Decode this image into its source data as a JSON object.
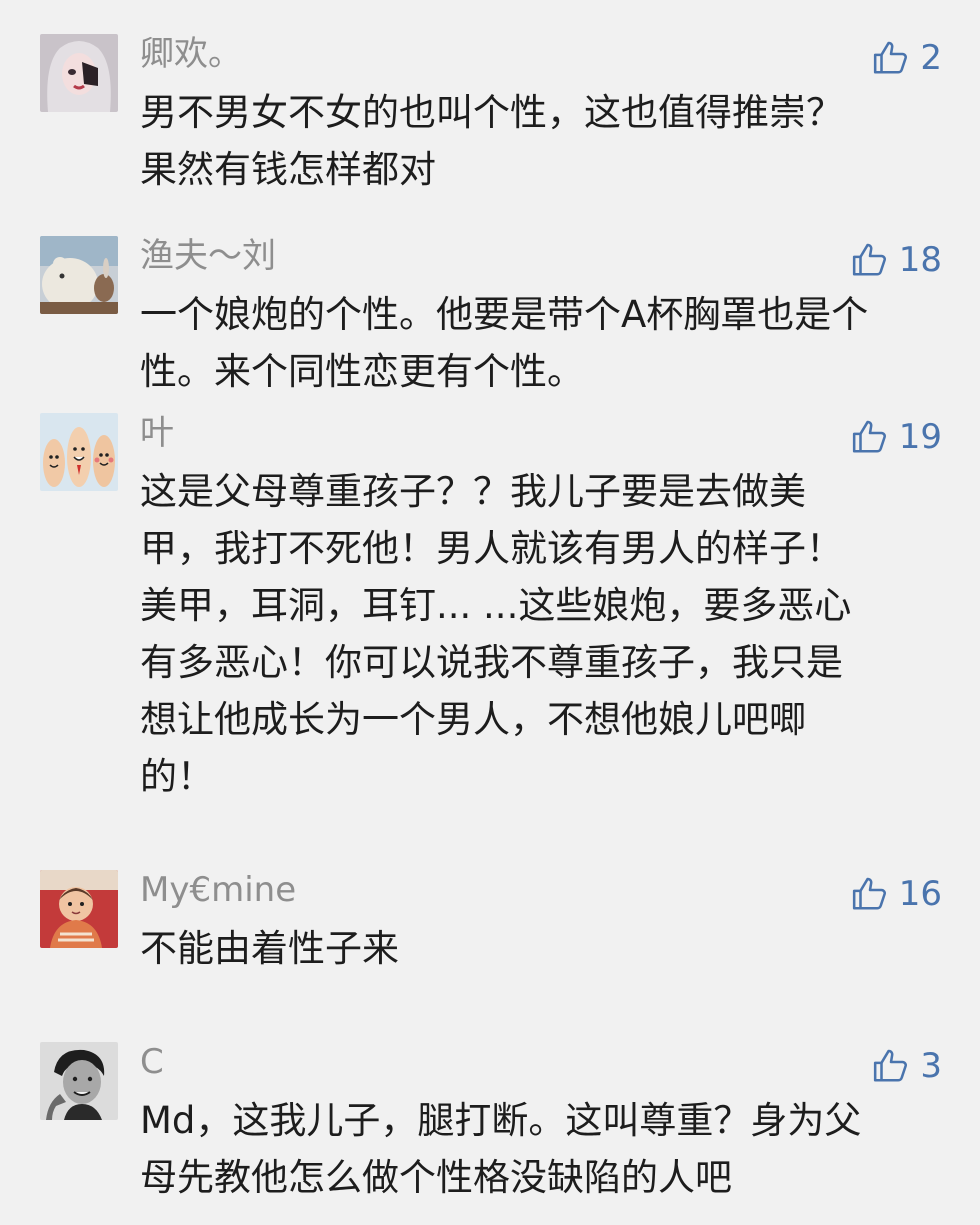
{
  "comments": [
    {
      "username": "卿欢。",
      "likes": "2",
      "avatar_icon": "girl-avatar-icon",
      "lines": [
        "男不男女不女的也叫个性，这也值得推崇？",
        "果然有钱怎样都对"
      ]
    },
    {
      "username": "渔夫～刘",
      "likes": "18",
      "avatar_icon": "polar-bear-avatar-icon",
      "lines": [
        "一个娘炮的个性。他要是带个A杯胸罩也是个",
        "性。来个同性恋更有个性。"
      ]
    },
    {
      "username": "叶",
      "likes": "19",
      "avatar_icon": "finger-faces-avatar-icon",
      "lines": [
        "这是父母尊重孩子？？我儿子要是去做美",
        "甲，我打不死他！男人就该有男人的样子！",
        "美甲，耳洞，耳钉... ...这些娘炮，要多恶心",
        "有多恶心！你可以说我不尊重孩子，我只是",
        "想让他成长为一个男人，不想他娘儿吧唧",
        "的！"
      ]
    },
    {
      "username": "My€mine",
      "likes": "16",
      "avatar_icon": "baby-avatar-icon",
      "lines": [
        "不能由着性子来"
      ]
    },
    {
      "username": "C",
      "likes": "3",
      "avatar_icon": "man-portrait-avatar-icon",
      "lines": [
        "Md，这我儿子，腿打断。这叫尊重？身为父",
        "母先教他怎么做个性格没缺陷的人吧"
      ]
    }
  ],
  "colors": {
    "background": "#f1f1f1",
    "username": "#8e8e8e",
    "like": "#4a74ad",
    "text": "#1d1d1d"
  },
  "like_icon": "thumbs-up-icon"
}
